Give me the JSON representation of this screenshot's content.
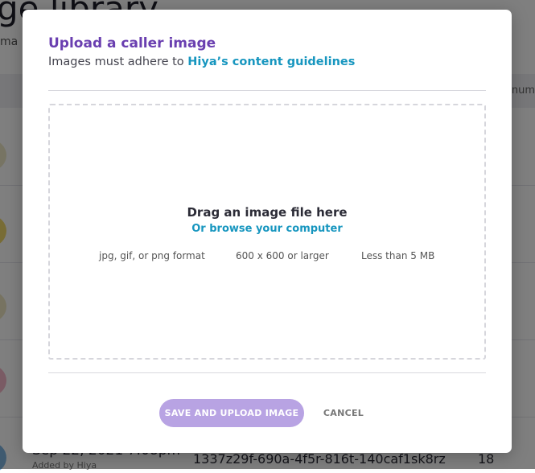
{
  "background": {
    "page_title": "ge library",
    "page_subtitle": "ma",
    "column_header": "e num",
    "last_row": {
      "date": "Sep 22, 2021 7:08pm",
      "added_by": "Added by Hiya",
      "id": "1337z29f-690a-4f5r-816t-140caf1sk8rz",
      "count": "18"
    },
    "avatar_colors": [
      "#efe9c6",
      "#f0d86a",
      "#efe7c2",
      "#f4b7c8",
      "#7fb4e0"
    ]
  },
  "modal": {
    "title": "Upload a caller image",
    "subtitle_prefix": "Images must adhere to ",
    "subtitle_link": "Hiya’s content guidelines",
    "dropzone": {
      "title": "Drag an image file here",
      "browse_link": "Or browse your computer",
      "requirements": [
        "jpg, gif, or png format",
        "600 x 600 or larger",
        "Less than 5 MB"
      ]
    },
    "buttons": {
      "save": "SAVE AND UPLOAD IMAGE",
      "cancel": "CANCEL"
    }
  },
  "colors": {
    "accent_purple": "#6a3fb0",
    "link_blue": "#1796bf",
    "save_button_disabled": "#b8a3e3"
  }
}
